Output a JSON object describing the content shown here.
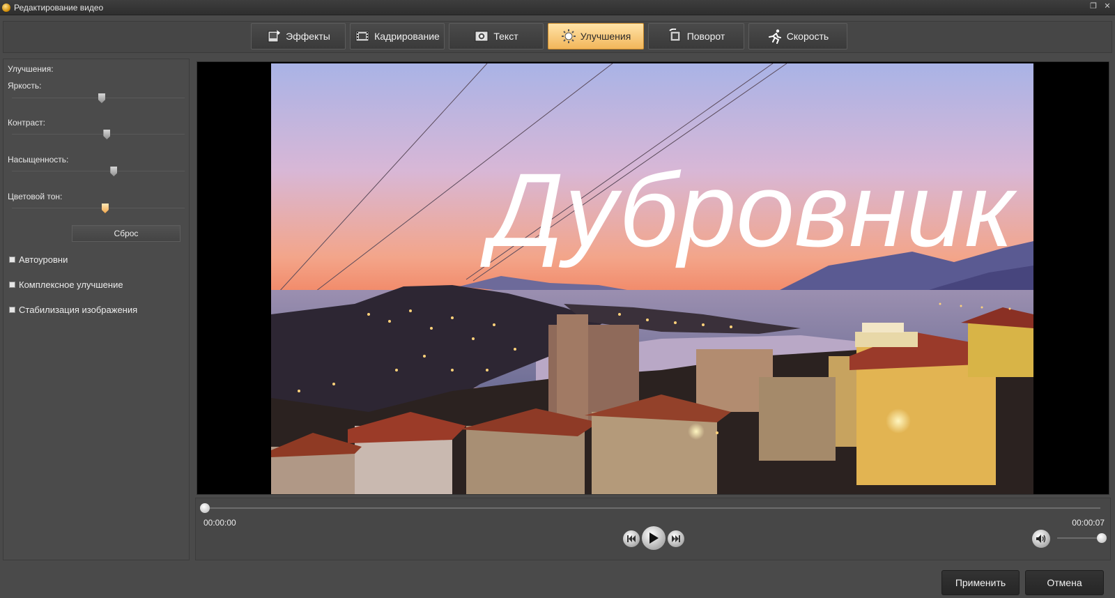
{
  "window": {
    "title": "Редактирование видео"
  },
  "tabs": [
    {
      "label": "Эффекты",
      "icon": "effects-icon",
      "active": false
    },
    {
      "label": "Кадрирование",
      "icon": "crop-film-icon",
      "active": false
    },
    {
      "label": "Текст",
      "icon": "text-icon",
      "active": false
    },
    {
      "label": "Улучшения",
      "icon": "sun-icon",
      "active": true
    },
    {
      "label": "Поворот",
      "icon": "rotate-icon",
      "active": false
    },
    {
      "label": "Скорость",
      "icon": "runner-icon",
      "active": false
    }
  ],
  "panel": {
    "heading": "Улучшения:",
    "sliders": [
      {
        "label": "Яркость:",
        "value": 0.52
      },
      {
        "label": "Контраст:",
        "value": 0.55
      },
      {
        "label": "Насыщенность:",
        "value": 0.59
      },
      {
        "label": "Цветовой тон:",
        "value": 0.54
      }
    ],
    "reset_label": "Сброс",
    "checkboxes": [
      {
        "label": "Автоуровни",
        "checked": false
      },
      {
        "label": "Комплексное улучшение",
        "checked": false
      },
      {
        "label": "Стабилизация изображения",
        "checked": false
      }
    ]
  },
  "preview": {
    "overlay_text": "Дубровник"
  },
  "player": {
    "time_current": "00:00:00",
    "time_total": "00:00:07",
    "progress": 0.0,
    "volume": 1.0
  },
  "footer": {
    "apply_label": "Применить",
    "cancel_label": "Отмена"
  },
  "colors": {
    "accent": "#f2b65a",
    "background": "#4a4a4a",
    "titlebar": "#2e2e2e"
  }
}
